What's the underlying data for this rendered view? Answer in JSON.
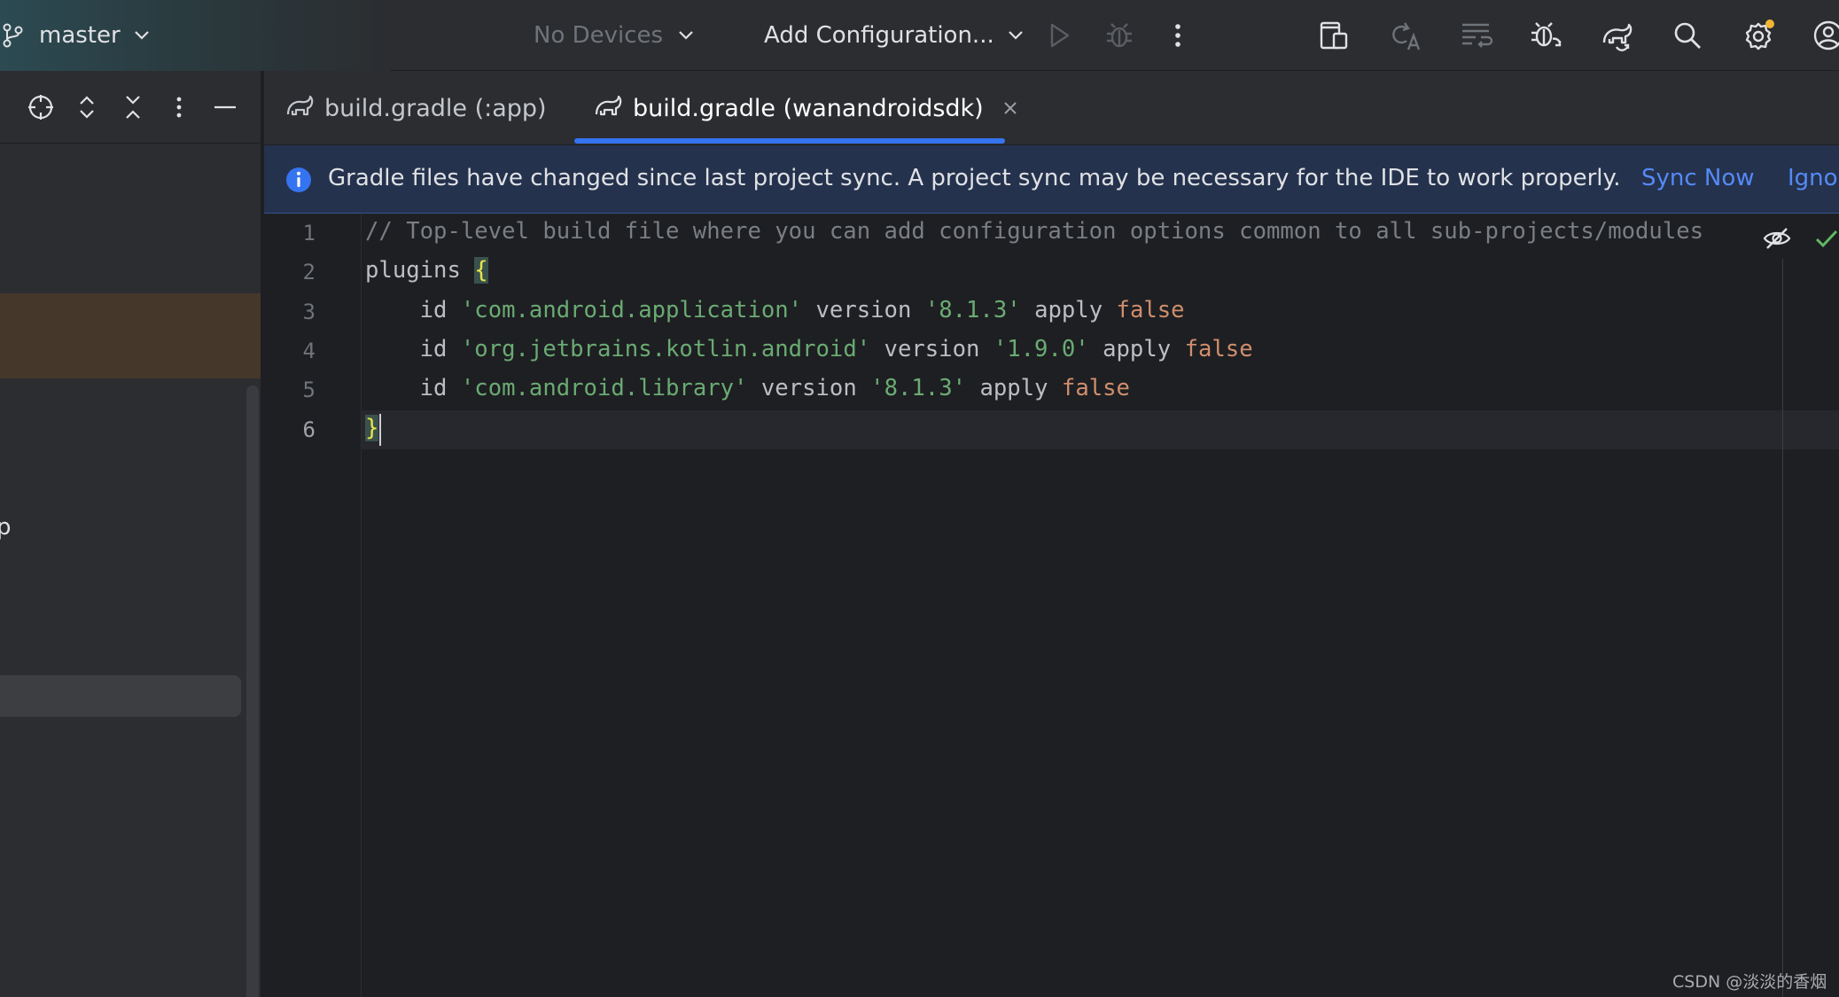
{
  "toolbar": {
    "branch": "master",
    "device_selector": "No Devices",
    "run_config": "Add Configuration...",
    "icons": [
      "branch-icon",
      "chevron-down-icon",
      "run-icon",
      "debug-icon",
      "more-vertical-icon",
      "device-manager-icon",
      "translate-icon",
      "code-style-icon",
      "debug-sync-icon",
      "gradle-sync-icon",
      "search-icon",
      "settings-icon",
      "account-icon"
    ],
    "settings_badge_color": "#f2b635"
  },
  "project_panel": {
    "clipped_text": "p",
    "icons": [
      "locate-icon",
      "expand-all-icon",
      "collapse-all-icon",
      "more-vertical-icon",
      "minimize-icon"
    ]
  },
  "tabs": [
    {
      "label": "build.gradle (:app)",
      "icon": "gradle-elephant-icon",
      "active": false
    },
    {
      "label": "build.gradle (wanandroidsdk)",
      "icon": "gradle-elephant-icon",
      "active": true,
      "closable": true
    }
  ],
  "banner": {
    "message": "Gradle files have changed since last project sync. A project sync may be necessary for the IDE to work properly.",
    "sync_action": "Sync Now",
    "ignore_action": "Ignor"
  },
  "editor": {
    "current_line": 6,
    "lines": [
      {
        "no": "1",
        "tokens": [
          {
            "t": "// Top-level build file where you can add configuration options common to all sub-projects/modules",
            "k": "comment"
          }
        ]
      },
      {
        "no": "2",
        "tokens": [
          {
            "t": "plugins ",
            "k": "plain"
          },
          {
            "t": "{",
            "k": "brace"
          }
        ]
      },
      {
        "no": "3",
        "tokens": [
          {
            "t": "    id ",
            "k": "plain"
          },
          {
            "t": "'com.android.application'",
            "k": "string"
          },
          {
            "t": " version ",
            "k": "plain"
          },
          {
            "t": "'8.1.3'",
            "k": "string"
          },
          {
            "t": " apply ",
            "k": "plain"
          },
          {
            "t": "false",
            "k": "bool"
          }
        ]
      },
      {
        "no": "4",
        "tokens": [
          {
            "t": "    id ",
            "k": "plain"
          },
          {
            "t": "'org.jetbrains.kotlin.android'",
            "k": "string"
          },
          {
            "t": " version ",
            "k": "plain"
          },
          {
            "t": "'1.9.0'",
            "k": "string"
          },
          {
            "t": " apply ",
            "k": "plain"
          },
          {
            "t": "false",
            "k": "bool"
          }
        ]
      },
      {
        "no": "5",
        "tokens": [
          {
            "t": "    id ",
            "k": "plain"
          },
          {
            "t": "'com.android.library'",
            "k": "string"
          },
          {
            "t": " version ",
            "k": "plain"
          },
          {
            "t": "'8.1.3'",
            "k": "string"
          },
          {
            "t": " apply ",
            "k": "plain"
          },
          {
            "t": "false",
            "k": "bool"
          }
        ]
      },
      {
        "no": "6",
        "tokens": [
          {
            "t": "}",
            "k": "brace"
          }
        ]
      }
    ]
  },
  "watermark": "CSDN @淡淡的香烟",
  "colors": {
    "accent": "#3574f0",
    "link": "#548af7",
    "string": "#6aab73",
    "keyword_bool": "#cf8e6d",
    "comment": "#7a7e85",
    "inspection_ok": "#5fb865"
  }
}
